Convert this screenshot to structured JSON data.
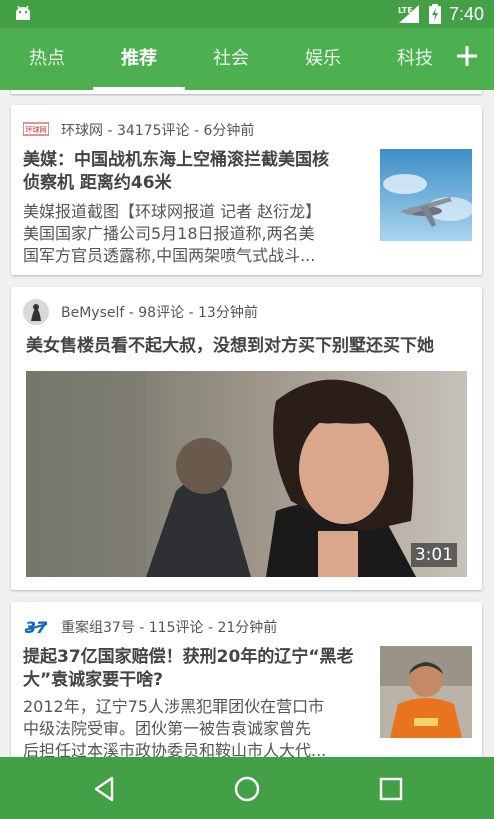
{
  "status_bar": {
    "network": "LTE",
    "time": "7:40"
  },
  "tabs": [
    {
      "label": "热点",
      "active": false
    },
    {
      "label": "推荐",
      "active": true
    },
    {
      "label": "社会",
      "active": false
    },
    {
      "label": "娱乐",
      "active": false
    },
    {
      "label": "科技",
      "active": false
    }
  ],
  "feed": [
    {
      "source": "环球网",
      "comments": "34175评论",
      "time": "6分钟前",
      "meta": "环球网 - 34175评论 - 6分钟前",
      "title_line1": "美媒：中国战机东海上空桶滚拦截美国核",
      "title_line2": "侦察机 距离约46米",
      "desc_line1": "美媒报道截图【环球网报道 记者 赵衍龙】",
      "desc_line2": "美国国家广播公司5月18日报道称,两名美",
      "desc_line3": "国军方官员透露称,中国两架喷气式战斗...",
      "logo_text": "环球网"
    },
    {
      "source": "BeMyself",
      "comments": "98评论",
      "time": "13分钟前",
      "meta": "BeMyself - 98评论 - 13分钟前",
      "title": "美女售楼员看不起大叔，没想到对方买下别墅还买下她",
      "duration": "3:01"
    },
    {
      "source": "重案组37号",
      "comments": "115评论",
      "time": "21分钟前",
      "meta": "重案组37号 - 115评论 - 21分钟前",
      "title_line1": "提起37亿国家赔偿！获刑20年的辽宁“黑老",
      "title_line2": "大”袁诚家要干啥?",
      "desc_line1": "2012年，辽宁75人涉黑犯罪团伙在营口市",
      "desc_line2": "中级法院受审。团伙第一被告袁诚家曾先",
      "desc_line3": "后担任过本溪市政协委员和鞍山市人大代..."
    }
  ],
  "colors": {
    "status_bar": "#43a047",
    "tab_bar": "#4caf50",
    "nav_bar": "#43a047"
  }
}
